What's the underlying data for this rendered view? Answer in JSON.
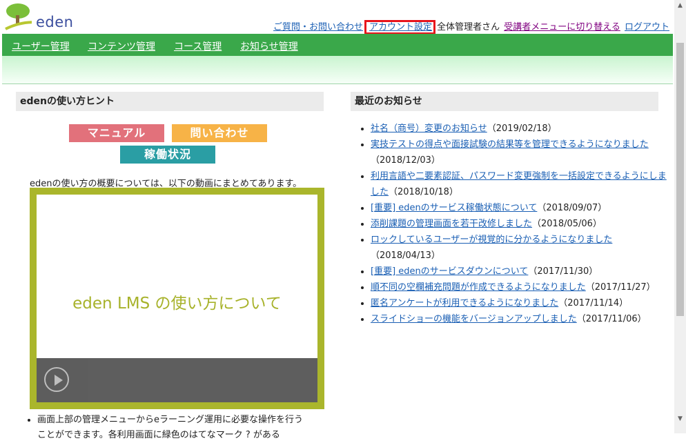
{
  "logo": {
    "text": "eden"
  },
  "toplinks": {
    "help": "ご質問・お問い合わせ",
    "account": "アカウント設定",
    "user": "全体管理者さん",
    "switch": "受講者メニューに切り替える",
    "logout": "ログアウト"
  },
  "nav": {
    "items": [
      "ユーザー管理",
      "コンテンツ管理",
      "コース管理",
      "お知らせ管理"
    ]
  },
  "hints": {
    "title": "edenの使い方ヒント",
    "buttons": {
      "manual": "マニュアル",
      "contact": "問い合わせ",
      "status": "稼働状況"
    },
    "description": "edenの使い方の概要については、以下の動画にまとめてあります。",
    "video_title": "eden LMS の使い方について",
    "bullet_1": "画面上部の管理メニューからeラーニング運用に必要な操作を行う",
    "bullet_2": "ことができます。各利用画面に緑色のはてなマーク ? がある"
  },
  "news": {
    "title": "最近のお知らせ",
    "items": [
      {
        "title": "社名（商号）変更のお知らせ",
        "date": "（2019/02/18）"
      },
      {
        "title": "実技テストの得点や面接試験の結果等を管理できるようになりました",
        "date": "（2018/12/03）"
      },
      {
        "title": "利用言語や二要素認証、パスワード変更強制を一括設定できるようにしました",
        "date": "（2018/10/18）"
      },
      {
        "title": "[重要] edenのサービス稼働状態について",
        "date": "（2018/09/07）"
      },
      {
        "title": "添削課題の管理画面を若干改修しました",
        "date": "（2018/05/06）"
      },
      {
        "title": "ロックしているユーザーが視覚的に分かるようになりました",
        "date": "（2018/04/13）"
      },
      {
        "title": "[重要] edenのサービスダウンについて",
        "date": "（2017/11/30）"
      },
      {
        "title": "順不同の空欄補充問題が作成できるようになりました",
        "date": "（2017/11/27）"
      },
      {
        "title": "匿名アンケートが利用できるようになりました",
        "date": "（2017/11/14）"
      },
      {
        "title": "スライドショーの機能をバージョンアップしました",
        "date": "（2017/11/06）"
      }
    ]
  },
  "colors": {
    "nav_green": "#3aa84a",
    "highlight_red": "#e8141c",
    "link_blue": "#1a5fb4"
  }
}
